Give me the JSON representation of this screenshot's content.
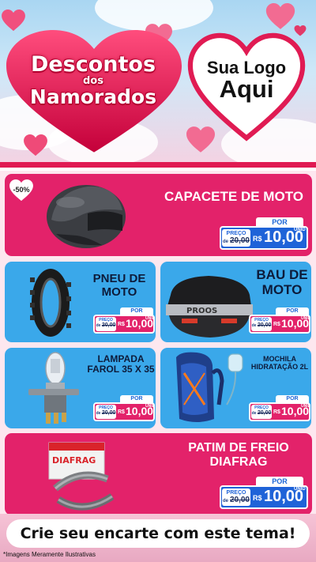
{
  "banner": {
    "title_line1": "Descontos",
    "title_line2": "dos",
    "title_line3": "Namorados",
    "logo_line1": "Sua Logo",
    "logo_line2": "Aqui"
  },
  "discount_badge": "-50%",
  "products": [
    {
      "name": "CAPACETE DE MOTO",
      "por": "POR",
      "preco": "PREÇO",
      "de": "de",
      "old_price": "20,00",
      "currency": "R$",
      "new_price": "10,00",
      "unit": "UNID"
    },
    {
      "name": "PNEU DE MOTO",
      "por": "POR",
      "preco": "PREÇO",
      "de": "de",
      "old_price": "20,00",
      "currency": "R$",
      "new_price": "10,00",
      "unit": "UNID"
    },
    {
      "name": "BAU DE MOTO",
      "por": "POR",
      "preco": "PREÇO",
      "de": "de",
      "old_price": "20,00",
      "currency": "R$",
      "new_price": "10,00",
      "unit": "UNID"
    },
    {
      "name": "LAMPADA FAROL 35 X 35",
      "por": "POR",
      "preco": "PREÇO",
      "de": "de",
      "old_price": "20,00",
      "currency": "R$",
      "new_price": "10,00",
      "unit": "UNID"
    },
    {
      "name": "MOCHILA HIDRATAÇÃO 2L",
      "por": "POR",
      "preco": "PREÇO",
      "de": "de",
      "old_price": "20,00",
      "currency": "R$",
      "new_price": "10,00",
      "unit": "UNID"
    },
    {
      "name": "PATIM DE FREIO DIAFRAG",
      "por": "POR",
      "preco": "PREÇO",
      "de": "de",
      "old_price": "20,00",
      "currency": "R$",
      "new_price": "10,00",
      "unit": "UNID"
    }
  ],
  "product_brands": {
    "bau": "PROOS",
    "patim": "DIAFRAG"
  },
  "cta": "Crie seu encarte com este tema!",
  "footnote": "*Imagens Meramente Ilustrativas",
  "colors": {
    "pink": "#e3226a",
    "blue": "#3aa8ea",
    "price_blue": "#1f63d8",
    "banner_red": "#e01b53"
  }
}
